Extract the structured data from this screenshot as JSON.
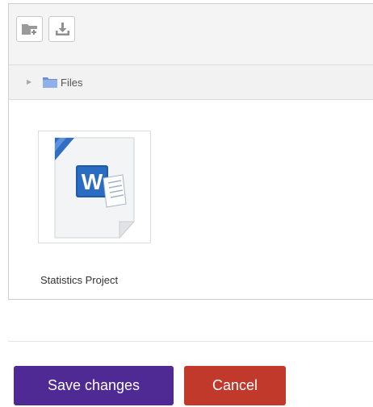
{
  "filemanager": {
    "toolbar": {
      "add_icon": "folder-add-icon",
      "download_icon": "download-icon"
    },
    "path": {
      "folder_label": "Files"
    },
    "files": [
      {
        "name": "Statistics Project",
        "icon": "word-document-icon"
      }
    ]
  },
  "actions": {
    "save_label": "Save changes",
    "cancel_label": "Cancel"
  },
  "colors": {
    "save": "#4f2a94",
    "cancel": "#c0392b",
    "folder": "#6a8fd4",
    "word_blue": "#1e5aa8"
  }
}
